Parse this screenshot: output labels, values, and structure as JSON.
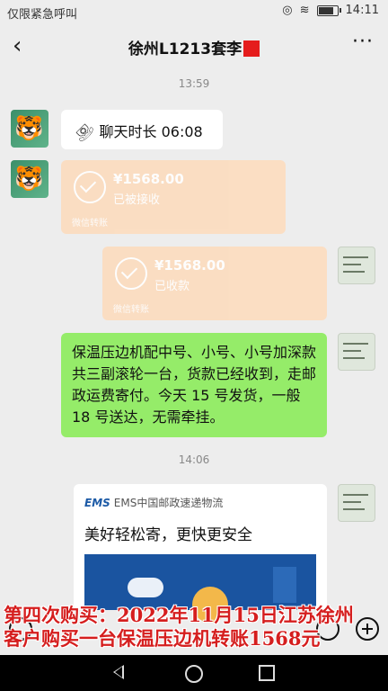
{
  "status_bar": {
    "left_text": "仅限紧急呼叫",
    "time": "14:11"
  },
  "header": {
    "title": "徐州L1213套李",
    "back_icon": "chevron-left-icon",
    "more_label": "···"
  },
  "messages": {
    "time1": "13:59",
    "call": {
      "label": "聊天时长 06:08"
    },
    "transfer1": {
      "amount": "¥1568.00",
      "status": "已被接收",
      "footer": "微信转账"
    },
    "transfer2": {
      "amount": "¥1568.00",
      "status": "已收款",
      "footer": "微信转账"
    },
    "green_text": "保温压边机配中号、小号、小号加深款共三副滚轮一台，货款已经收到，走邮政运费寄付。今天 15 号发货，一般 18 号送达，无需牵挂。",
    "time2": "14:06",
    "ems": {
      "logo": "EMS",
      "source": "EMS中国邮政速递物流",
      "title": "美好轻松寄，更快更安全"
    }
  },
  "overlay": {
    "line1": "第四次购买：2022年11月15日江苏徐州",
    "line2": "客户购买一台保温压边机转账1568元"
  },
  "colors": {
    "green_bubble": "#95ec69",
    "transfer_bubble": "#fcdcbf",
    "overlay_red": "#d51e1e"
  }
}
